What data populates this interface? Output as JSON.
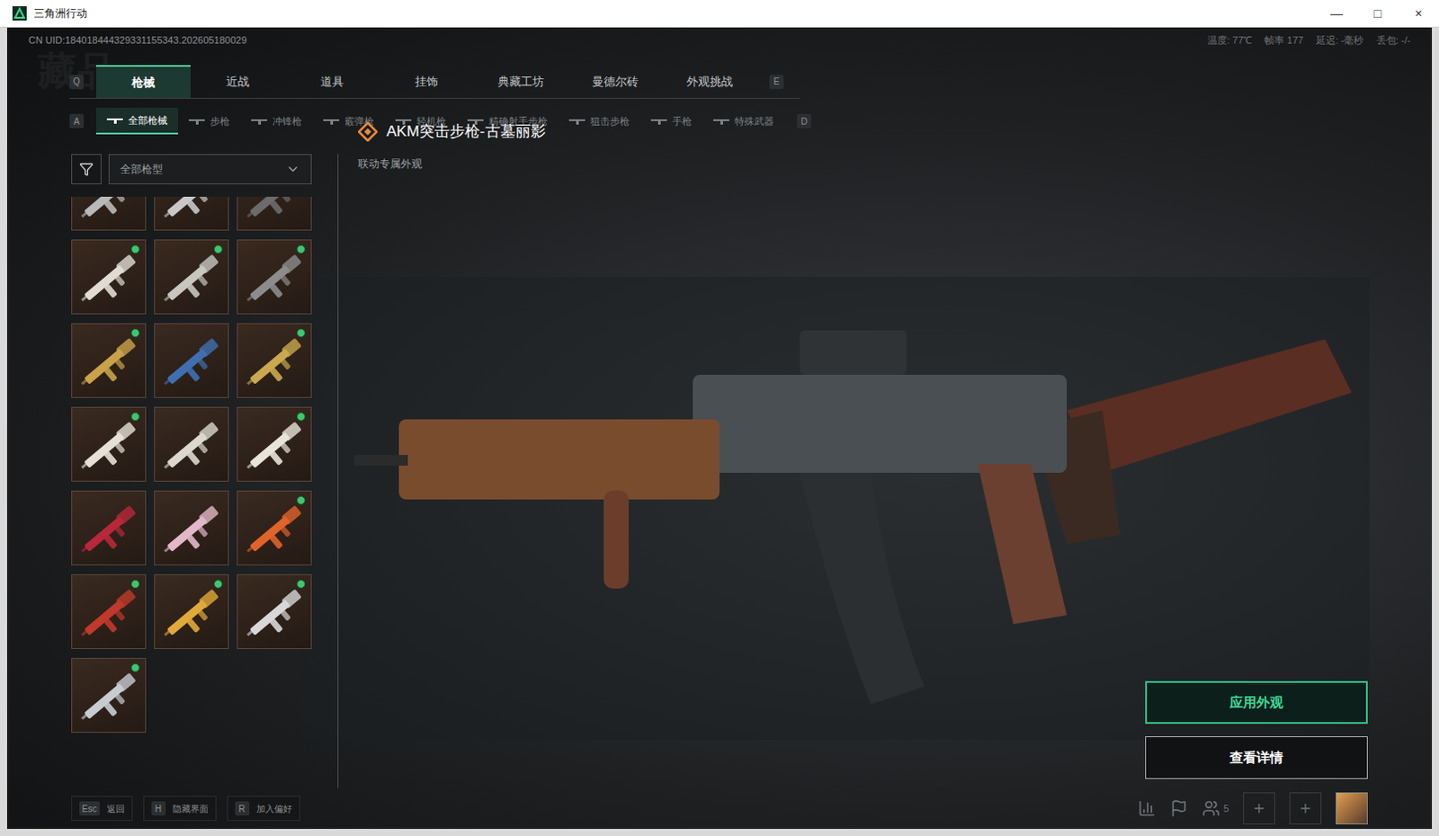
{
  "window": {
    "title": "三角洲行动",
    "controls": [
      "—",
      "□",
      "×"
    ]
  },
  "uid": "CN UID:184018444329331155343.202605180029",
  "watermark": "藏品",
  "stats": [
    "温度: 77℃",
    "帧率 177",
    "延迟: -毫秒",
    "丢包: -/-"
  ],
  "tabs": {
    "prev_key": "Q",
    "next_key": "E",
    "items": [
      {
        "label": "枪械",
        "selected": true
      },
      {
        "label": "近战",
        "selected": false
      },
      {
        "label": "道具",
        "selected": false
      },
      {
        "label": "挂饰",
        "selected": false
      },
      {
        "label": "典藏工坊",
        "selected": false
      },
      {
        "label": "曼德尔砖",
        "selected": false
      },
      {
        "label": "外观挑战",
        "selected": false
      }
    ]
  },
  "subtabs": {
    "prev_key": "A",
    "next_key": "D",
    "items": [
      {
        "label": "全部枪械",
        "selected": true
      },
      {
        "label": "步枪",
        "selected": false
      },
      {
        "label": "冲锋枪",
        "selected": false
      },
      {
        "label": "霰弹枪",
        "selected": false
      },
      {
        "label": "轻机枪",
        "selected": false
      },
      {
        "label": "精确射手步枪",
        "selected": false
      },
      {
        "label": "狙击步枪",
        "selected": false
      },
      {
        "label": "手枪",
        "selected": false
      },
      {
        "label": "特殊武器",
        "selected": false
      }
    ]
  },
  "filter": {
    "value": "全部枪型"
  },
  "skins": [
    {
      "owned": false,
      "color": "#b9b9b9"
    },
    {
      "owned": false,
      "color": "#c8c8c8"
    },
    {
      "owned": false,
      "color": "#6b6b6b"
    },
    {
      "owned": true,
      "color": "#e0dcd4"
    },
    {
      "owned": true,
      "color": "#c9c6c0"
    },
    {
      "owned": true,
      "color": "#8c8c8c"
    },
    {
      "owned": true,
      "color": "#c9a24a"
    },
    {
      "owned": false,
      "color": "#3f6fb0"
    },
    {
      "owned": true,
      "color": "#c9a84f"
    },
    {
      "owned": true,
      "color": "#e6e1d6"
    },
    {
      "owned": false,
      "color": "#dcd8cf"
    },
    {
      "owned": true,
      "color": "#e8e4da"
    },
    {
      "owned": false,
      "color": "#b8283a"
    },
    {
      "owned": false,
      "color": "#e2b8c8"
    },
    {
      "owned": true,
      "color": "#e0632a"
    },
    {
      "owned": true,
      "color": "#c0392b"
    },
    {
      "owned": true,
      "color": "#e0a93a"
    },
    {
      "owned": true,
      "color": "#d8d8d8"
    },
    {
      "owned": true,
      "color": "#c8ccd2"
    }
  ],
  "detail": {
    "title": "AKM突击步枪-古墓丽影",
    "tag": "联动专属外观"
  },
  "buttons": [
    {
      "label": "应用外观",
      "primary": true
    },
    {
      "label": "查看详情",
      "primary": false
    }
  ],
  "hints": [
    {
      "key": "Esc",
      "label": "返回"
    },
    {
      "key": "H",
      "label": "隐藏界面"
    },
    {
      "key": "R",
      "label": "加入偏好"
    }
  ],
  "social": {
    "friends": "5"
  }
}
